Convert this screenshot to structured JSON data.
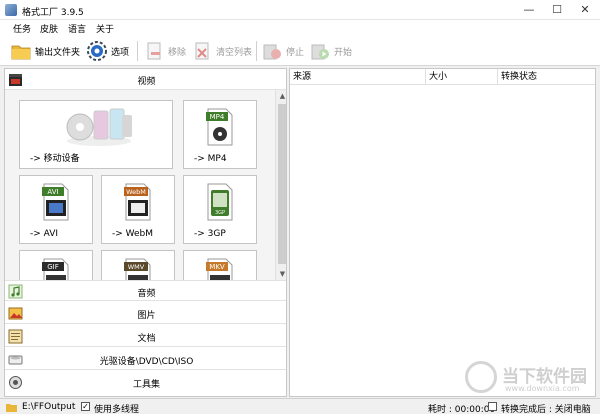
{
  "window": {
    "title": "格式工厂 3.9.5",
    "minimize_glyph": "—",
    "maximize_glyph": "☐",
    "close_glyph": "✕"
  },
  "menu": {
    "items": [
      {
        "label": "任务"
      },
      {
        "label": "皮肤"
      },
      {
        "label": "语言"
      },
      {
        "label": "关于"
      }
    ]
  },
  "toolbar": {
    "output_folder": "输出文件夹",
    "options": "选项",
    "remove": "移除",
    "clear_list": "清空列表",
    "stop": "停止",
    "start": "开始"
  },
  "categories": {
    "video": "视频",
    "audio": "音频",
    "image": "图片",
    "document": "文档",
    "disc": "光驱设备\\DVD\\CD\\ISO",
    "tools": "工具集"
  },
  "tiles": [
    {
      "label": "-> 移动设备",
      "icon": "mobile-device-icon"
    },
    {
      "label": "-> MP4",
      "badge": "MP4",
      "icon": "mp4-file-icon"
    },
    {
      "label": "-> AVI",
      "badge": "AVI",
      "icon": "avi-file-icon"
    },
    {
      "label": "-> WebM",
      "badge": "WebM",
      "icon": "webm-file-icon"
    },
    {
      "label": "-> 3GP",
      "badge": "3GP",
      "icon": "3gp-file-icon"
    },
    {
      "label": "",
      "badge": "GIF",
      "icon": "gif-file-icon"
    },
    {
      "label": "",
      "badge": "WMV",
      "icon": "wmv-file-icon"
    },
    {
      "label": "",
      "badge": "MKV",
      "icon": "mkv-file-icon"
    }
  ],
  "task_list": {
    "columns": [
      "来源",
      "大小",
      "转换状态"
    ]
  },
  "status": {
    "output_path": "E:\\FFOutput",
    "multithread_label": "使用多线程",
    "multithread_checked": "✓",
    "elapsed": "耗时 : 00:00:00",
    "after_convert_label": "转换完成后 : 关闭电脑"
  },
  "watermark": {
    "text": "当下软件园",
    "url": "www.downxia.com"
  },
  "colors": {
    "accent_blue": "#2a6cc4",
    "file_badge_green": "#3f7d2a",
    "file_badge_dark": "#2b2b2b"
  }
}
